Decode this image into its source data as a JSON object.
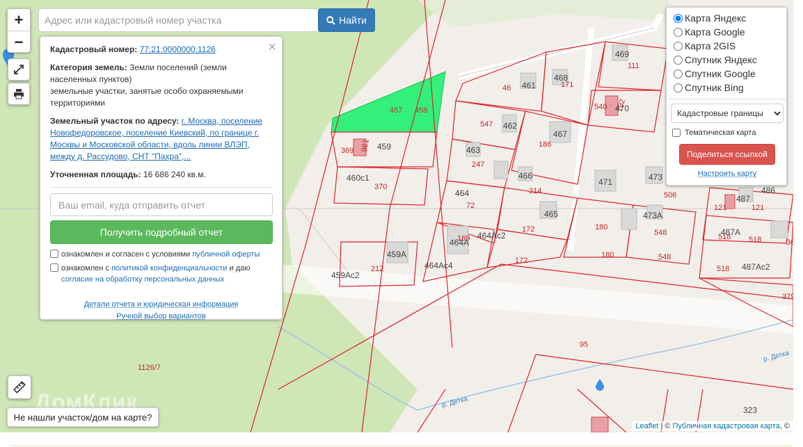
{
  "search": {
    "placeholder": "Адрес или кадастровый номер участка",
    "button_label": "Найти"
  },
  "zoom": {
    "in_label": "+",
    "out_label": "−"
  },
  "info_panel": {
    "cadastral_label": "Кадастровый номер:",
    "cadastral_value": "77:21:0000000:1126",
    "category_label": "Категория земель:",
    "category_value": "Земли поселений (земли населенных пунктов)",
    "category_extra": "земельные участки, занятые особо охраняемыми территориями",
    "address_label": "Земельный участок по адресу:",
    "address_value": "г. Москва, поселение Новофедоровское, поселение Киевский, по границе г. Москвы и Московской области, вдоль линии ВЛЭП, между д. Рассудово, СНТ \"Пахра\",...",
    "area_label": "Уточненная площадь:",
    "area_value": "16 686 240 кв.м.",
    "email_placeholder": "Ваш email, куда отправить отчет",
    "report_button": "Получить подробный отчет",
    "consent1_prefix": "ознакомлен и согласен с условиями ",
    "consent1_link": "публичной оферты",
    "consent2_prefix": "ознакомлен с ",
    "consent2_link": "политикой конфиденциальности",
    "consent2_mid": " и даю ",
    "consent2_link2": "согласие на обработку персональных данных",
    "details_link": "Детали отчета и юридическая информация",
    "manual_link": "Ручной выбор вариантов",
    "close_label": "×"
  },
  "layers": {
    "options": [
      {
        "label": "Карта Яндекс",
        "checked": true
      },
      {
        "label": "Карта Google",
        "checked": false
      },
      {
        "label": "Карта 2GIS",
        "checked": false
      },
      {
        "label": "Спутник Яндекс",
        "checked": false
      },
      {
        "label": "Спутник Google",
        "checked": false
      },
      {
        "label": "Спутник Bing",
        "checked": false
      }
    ],
    "select_value": "Кадастровые границы",
    "thematic_label": "Тематическая карта",
    "share_button": "Поделиться ссылкой",
    "setup_link": "Настроить карту"
  },
  "not_found": "Не нашли участок/дом на карте?",
  "attribution": {
    "leaflet": "Leaflet",
    "sep": " | © ",
    "source": "Публичная кадастровая карта",
    "tail": ", ©"
  },
  "watermark": "ДомКлик",
  "map_labels": {
    "parcels": [
      "457",
      "458",
      "459",
      "369",
      "981",
      "460с1",
      "370",
      "461",
      "46",
      "468",
      "171",
      "469",
      "111",
      "540",
      "702",
      "470",
      "547",
      "462",
      "467",
      "186",
      "463",
      "247",
      "466",
      "214",
      "464",
      "72",
      "465",
      "172",
      "169",
      "464Ас2",
      "464Ас4",
      "464А",
      "459А",
      "212",
      "459Ас2",
      "180",
      "471",
      "473",
      "506",
      "473А",
      "548",
      "121",
      "487",
      "486",
      "518",
      "487А",
      "487Ас2",
      "36",
      "379",
      "95",
      "323",
      "1126/7"
    ],
    "rivers": [
      "р. Детка",
      "р. Детка"
    ]
  },
  "colors": {
    "parcel_border": "#e0222a",
    "highlight_fill": "#32f07a",
    "forest": "#cfe6b7",
    "road": "#ffffff",
    "primary": "#337ab7",
    "success": "#5cb85c",
    "danger": "#d9534f"
  }
}
